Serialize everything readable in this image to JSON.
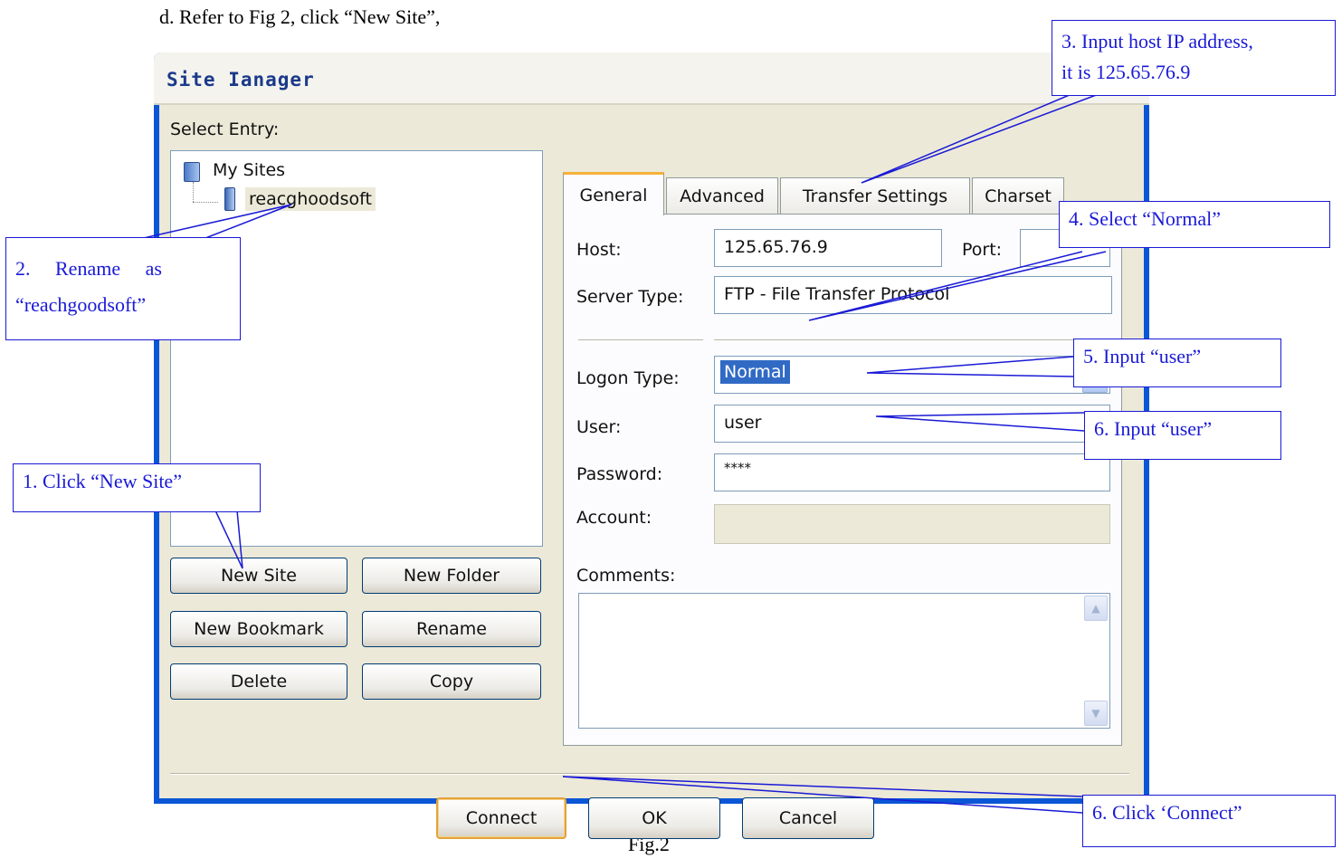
{
  "doc": {
    "step_text": "d.   Refer to Fig 2, click “New Site”,",
    "caption": "Fig.2"
  },
  "window": {
    "title": "Site Ianager",
    "select_entry_label": "Select Entry:",
    "tree": {
      "root": "My Sites",
      "site": "reacghoodsoft"
    },
    "left_buttons": [
      "New Site",
      "New Folder",
      "New Bookmark",
      "Rename",
      "Delete",
      "Copy"
    ],
    "tabs": [
      "General",
      "Advanced",
      "Transfer Settings",
      "Charset"
    ],
    "active_tab": "General",
    "general": {
      "host_label": "Host:",
      "host_value": "125.65.76.9",
      "port_label": "Port:",
      "port_value": "",
      "server_type_label": "Server Type:",
      "server_type_value": "FTP - File Transfer Protocol",
      "logon_type_label": "Logon Type:",
      "logon_type_value": "Normal",
      "user_label": "User:",
      "user_value": "user",
      "password_label": "Password:",
      "password_value": "****",
      "account_label": "Account:",
      "account_value": "",
      "comments_label": "Comments:",
      "comments_value": ""
    },
    "bottom_buttons": [
      "Connect",
      "OK",
      "Cancel"
    ]
  },
  "annotations": {
    "step1": "1. Click “New Site”",
    "step2_line1": "2.     Rename     as",
    "step2_line2": "“reachgoodsoft”",
    "step3_line1": "3. Input host IP address,",
    "step3_line2": "it is 125.65.76.9",
    "step4": "4. Select “Normal”",
    "step5": "5. Input “user”",
    "step6a": "6. Input “user”",
    "step6b": "6. Click ‘Connect”"
  },
  "colors": {
    "annotation_blue": "#1a1ad6",
    "window_frame": "#0a56d6",
    "dialog_bg": "#ece9d8",
    "selection": "#316ac5"
  }
}
